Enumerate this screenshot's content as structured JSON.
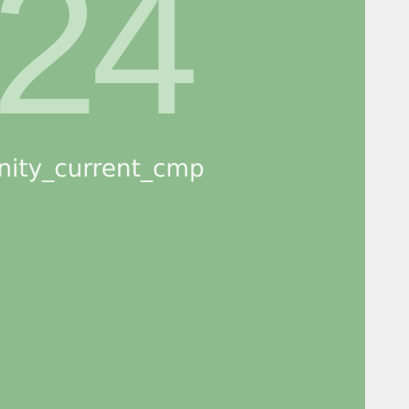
{
  "card": {
    "number": "24",
    "caption": "nity_current_cmp"
  },
  "colors": {
    "card_background": "#8dbb8d",
    "number_text": "#c5e1c5",
    "caption_text": "#f2f7f2",
    "page_background": "#efefef"
  }
}
